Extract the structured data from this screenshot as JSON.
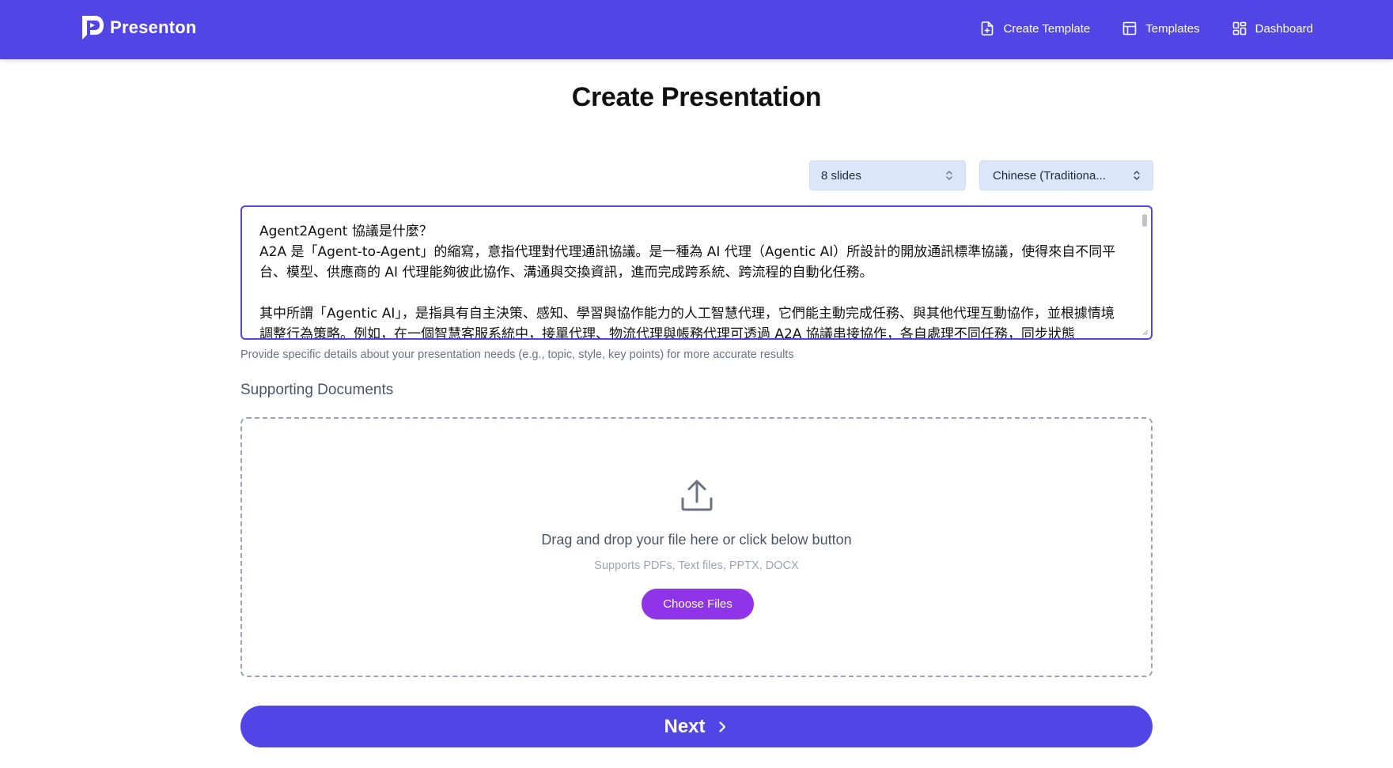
{
  "app": {
    "name": "Presenton",
    "brand_color": "#5146e5",
    "accent_color": "#9034ea"
  },
  "nav": [
    {
      "label": "Create Template",
      "icon": "file-plus-icon"
    },
    {
      "label": "Templates",
      "icon": "layout-icon"
    },
    {
      "label": "Dashboard",
      "icon": "grid-icon"
    }
  ],
  "page": {
    "title": "Create Presentation"
  },
  "controls": {
    "slides_value": "8 slides",
    "language_value": "Chinese (Traditiona..."
  },
  "prompt": {
    "text": "Agent2Agent 協議是什麼？\nA2A 是「Agent-to-Agent」的縮寫，意指代理對代理通訊協議。是一種為 AI 代理（Agentic AI）所設計的開放通訊標準協議，使得來自不同平台、模型、供應商的 AI 代理能夠彼此協作、溝通與交換資訊，進而完成跨系統、跨流程的自動化任務。\n\n其中所謂「Agentic AI」，是指具有自主決策、感知、學習與協作能力的人工智慧代理，它們能主動完成任務、與其他代理互動協作，並根據情境調整行為策略。例如，在一個智慧客服系統中，接單代理、物流代理與帳務代理可透過 A2A 協議串接協作，各自處理不同任務，同步狀態",
    "hint": "Provide specific details about your presentation needs (e.g., topic, style, key points) for more accurate results"
  },
  "documents": {
    "label": "Supporting Documents",
    "drop_title": "Drag and drop your file here or click below button",
    "drop_subtitle": "Supports PDFs, Text files, PPTX, DOCX",
    "choose_label": "Choose Files"
  },
  "footer": {
    "next_label": "Next"
  }
}
